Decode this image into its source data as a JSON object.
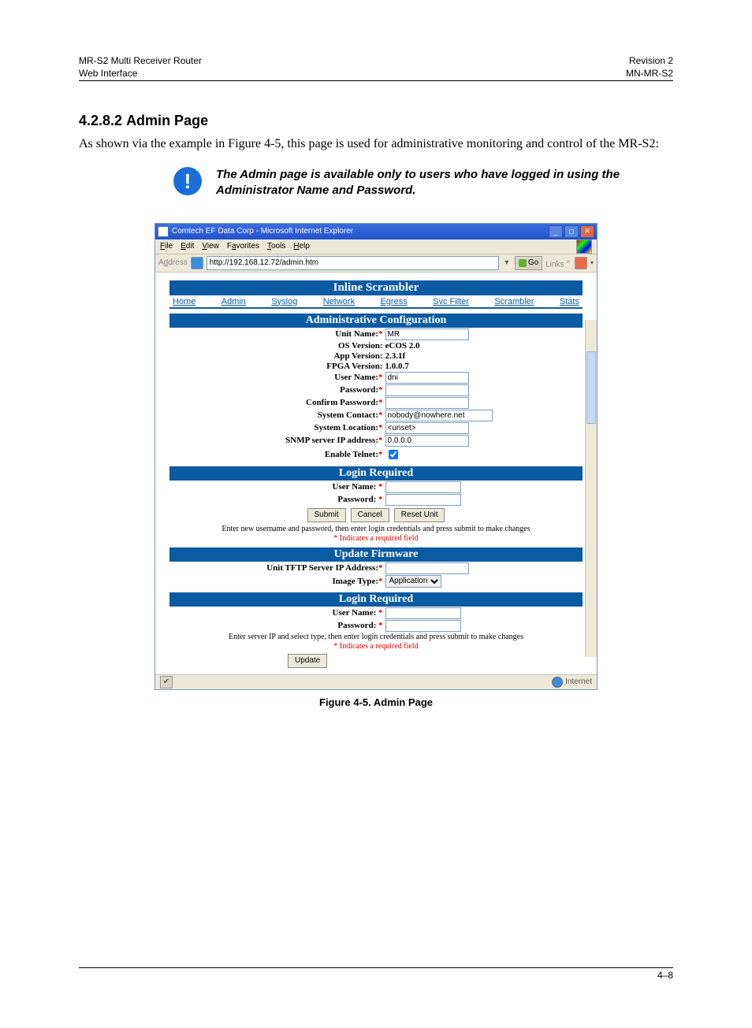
{
  "doc": {
    "header_left": "MR-S2 Multi Receiver Router",
    "header_right": "Revision 2",
    "section_left": "Web Interface",
    "section_right": "MN-MR-S2",
    "section_number": "4.2.8.2",
    "section_title": "Admin Page",
    "intro": "As shown via the example in Figure 4-5, this page is used for administrative monitoring and control of the MR-S2:",
    "callout": "The Admin page is available only to users who have logged in using the Administrator Name and Password.",
    "figure_caption": "Figure 4-5. Admin Page",
    "footer_page": "4–8"
  },
  "browser": {
    "title": "Comtech EF Data Corp - Microsoft Internet Explorer",
    "menu": {
      "file": "File",
      "edit": "Edit",
      "view": "View",
      "favorites": "Favorites",
      "tools": "Tools",
      "help": "Help"
    },
    "address_label": "Address",
    "url": "http://192.168.12.72/admin.htm",
    "go": "Go",
    "links": "Links",
    "status_zone": "Internet"
  },
  "app": {
    "title": "Inline Scrambler",
    "nav": {
      "home": "Home",
      "admin": "Admin",
      "syslog": "Syslog",
      "network": "Network",
      "egress": "Egress",
      "svcfilter": "Svc Filter",
      "scrambler": "Scrambler",
      "stats": "Stats"
    },
    "admin_section": "Administrative Configuration",
    "fields": {
      "unit_name_label": "Unit Name:",
      "unit_name": "MR",
      "os_label": "OS Version:",
      "os": "eCOS 2.0",
      "app_label": "App Version:",
      "app": "2.3.1f",
      "fpga_label": "FPGA Version:",
      "fpga": "1.0.0.7",
      "user_label": "User Name:",
      "user": "dni",
      "pwd_label": "Password:",
      "cpw_label": "Confirm Password:",
      "contact_label": "System Contact:",
      "contact": "nobody@nowhere.net",
      "location_label": "System Location:",
      "location": "<unset>",
      "snmp_label": "SNMP server IP address:",
      "snmp": "0.0.0.0",
      "telnet_label": "Enable Telnet:"
    },
    "login_section": "Login Required",
    "login": {
      "user_label": "User Name:",
      "pwd_label": "Password:"
    },
    "buttons": {
      "submit": "Submit",
      "cancel": "Cancel",
      "reset": "Reset Unit",
      "update": "Update"
    },
    "note1": "Enter new username and password, then enter login credentials and press submit to make changes",
    "required_note": "* Indicates a required field",
    "fw_section": "Update Firmware",
    "fw": {
      "tftp_label": "Unit TFTP Server IP Address:",
      "imgtype_label": "Image Type:",
      "imgtype": "Application"
    },
    "note2": "Enter server IP and select type, then enter login credentials and press submit to make changes"
  }
}
